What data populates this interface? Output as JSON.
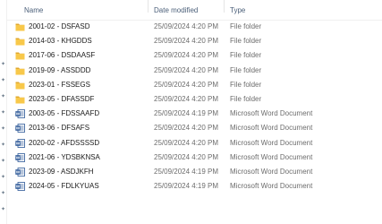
{
  "columns": {
    "name": "Name",
    "date": "Date modified",
    "type": "Type"
  },
  "rows": [
    {
      "name": "2001-02 - DSFASD",
      "date": "25/09/2024 4:20 PM",
      "type": "File folder",
      "icon": "folder-icon"
    },
    {
      "name": "2014-03 - KHGDDS",
      "date": "25/09/2024 4:20 PM",
      "type": "File folder",
      "icon": "folder-icon"
    },
    {
      "name": "2017-06 - DSDAASF",
      "date": "25/09/2024 4:20 PM",
      "type": "File folder",
      "icon": "folder-icon"
    },
    {
      "name": "2019-09 - ASSDDD",
      "date": "25/09/2024 4:20 PM",
      "type": "File folder",
      "icon": "folder-icon"
    },
    {
      "name": "2023-01 - FSSEGS",
      "date": "25/09/2024 4:20 PM",
      "type": "File folder",
      "icon": "folder-icon"
    },
    {
      "name": "2023-05 - DFASSDF",
      "date": "25/09/2024 4:20 PM",
      "type": "File folder",
      "icon": "folder-icon"
    },
    {
      "name": "2003-05 - FDSSAAFD",
      "date": "25/09/2024 4:19 PM",
      "type": "Microsoft Word Document",
      "icon": "word-document-icon"
    },
    {
      "name": "2013-06 - DFSAFS",
      "date": "25/09/2024 4:20 PM",
      "type": "Microsoft Word Document",
      "icon": "word-document-icon"
    },
    {
      "name": "2020-02 - AFDSSSSD",
      "date": "25/09/2024 4:20 PM",
      "type": "Microsoft Word Document",
      "icon": "word-document-icon"
    },
    {
      "name": "2021-06 - YDSBKNSA",
      "date": "25/09/2024 4:20 PM",
      "type": "Microsoft Word Document",
      "icon": "word-document-icon"
    },
    {
      "name": "2023-09 - ASDJKFH",
      "date": "25/09/2024 4:19 PM",
      "type": "Microsoft Word Document",
      "icon": "word-document-icon"
    },
    {
      "name": "2024-05 - FDLKYUAS",
      "date": "25/09/2024 4:19 PM",
      "type": "Microsoft Word Document",
      "icon": "word-document-icon"
    }
  ],
  "colors": {
    "folder": "#f8c84a",
    "folder_dark": "#e0a82e",
    "word": "#2b5797",
    "header_text": "#4c607a",
    "muted_text": "#6d6d6d"
  }
}
